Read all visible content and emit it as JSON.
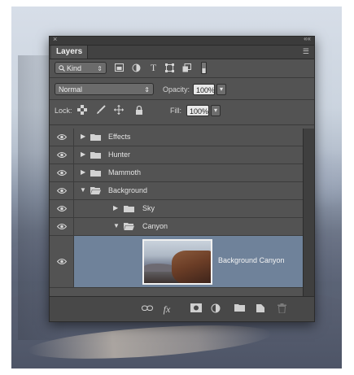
{
  "panel": {
    "title": "Layers",
    "close_glyph": "×",
    "collapse_glyph": "««",
    "menu_glyph": "☰"
  },
  "filter": {
    "kind_label": "Kind",
    "kind_arrow": "⇕",
    "icons": [
      "image-filter-icon",
      "adjustment-filter-icon",
      "type-filter-icon",
      "shape-filter-icon",
      "smart-object-filter-icon",
      "filter-toggle-icon"
    ]
  },
  "blend": {
    "mode": "Normal",
    "arrow": "⇕",
    "opacity_label": "Opacity:",
    "opacity_value": "100%",
    "opacity_arrow": "▾"
  },
  "lock": {
    "label": "Lock:",
    "fill_label": "Fill:",
    "fill_value": "100%",
    "fill_arrow": "▾"
  },
  "layers": [
    {
      "name": "Effects",
      "indent": 0,
      "expanded": false
    },
    {
      "name": "Hunter",
      "indent": 0,
      "expanded": false
    },
    {
      "name": "Mammoth",
      "indent": 0,
      "expanded": false
    },
    {
      "name": "Background",
      "indent": 0,
      "expanded": true
    },
    {
      "name": "Sky",
      "indent": 1,
      "expanded": false
    },
    {
      "name": "Canyon",
      "indent": 1,
      "expanded": true
    }
  ],
  "selected_layer": {
    "name": "Background Canyon"
  },
  "bottom_icons": [
    "link-layers-icon",
    "fx-icon",
    "add-mask-icon",
    "new-adjustment-icon",
    "new-group-icon",
    "new-layer-icon",
    "delete-layer-icon"
  ],
  "fx_glyph": "fx",
  "colors": {
    "panel_bg": "#535353",
    "selected_row": "#6f829a"
  }
}
